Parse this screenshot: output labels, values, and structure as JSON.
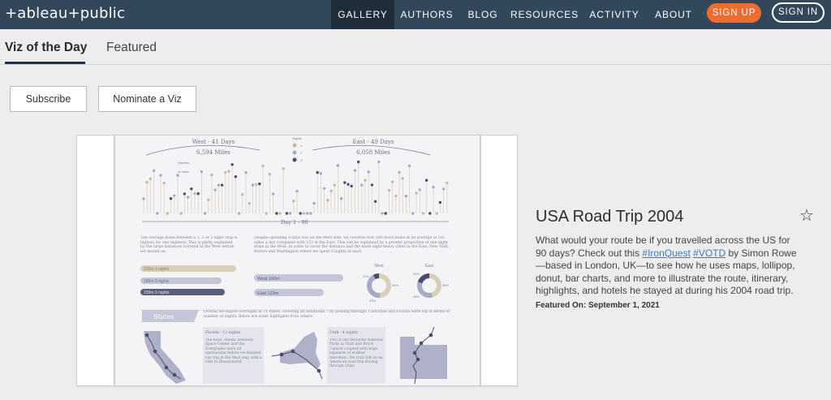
{
  "logo": {
    "text": "+ableau+public"
  },
  "nav": {
    "items": [
      "GALLERY",
      "AUTHORS",
      "BLOG",
      "RESOURCES",
      "ACTIVITY",
      "ABOUT"
    ],
    "sign_up": "SIGN UP",
    "sign_in": "SIGN IN"
  },
  "tabs": {
    "active": "Viz of the Day",
    "other": "Featured"
  },
  "actions": {
    "subscribe": "Subscribe",
    "nominate": "Nominate a Viz"
  },
  "viz": {
    "title": "USA Road Trip 2004",
    "desc_part1": "What would your route be if you travelled across the US for 90 days? Check out this ",
    "tag1": "#IronQuest",
    "tag2": "#VOTD",
    "desc_part2": " by Simon Rowe—based in London, UK—to see how he uses maps, lollipop, donut, bar charts, and more to illustrate the route, itinerary, highlights, and hotels he stayed at during his 2004 road trip.",
    "featured_on": "Featured On: September 1, 2021",
    "star_icon": "star-outline-icon"
  },
  "thumbnail": {
    "west_label": "West - 41 Days",
    "west_miles": "6,594 Miles",
    "east_label": "East - 49 Days",
    "east_miles": "6,058 Miles",
    "nights_label": "Nights",
    "nights_values": [
      "1",
      "2",
      "3"
    ],
    "number_label": "Number",
    "number_unit": "of miles",
    "axis_label": "Day 1 - 90",
    "left_text": "The average miles between a 1, 2 or 3 night stop is highest for one nighters. This is partly explained by the large distances covered in the West before we moved on.",
    "center_text": "Despite spending 8 days less on the West side, we covered over 500 more miles at an average of 161 miles a day compared with 123 in the East. This can be explained by a greater proportion of one night stops in the West, in order to cover the distance and the more sight-heavy cities in the East, New York, Boston and Washington where we spent 3 nights at each.",
    "bars": [
      "229m 1 nights",
      "186m 2 nights",
      "159m 3 nights"
    ],
    "west_bar": "West 160m",
    "east_bar": "East 123m",
    "donut_west": "West",
    "donut_east": "East",
    "donut_west_pcts": [
      "23%",
      "44%",
      "33%"
    ],
    "donut_east_pcts": [
      "20%",
      "35%",
      "45%"
    ],
    "states_title": "States",
    "states_text": "Overall we stayed overnight in 31 states, covering an additional 7 by passing through. California and Florida were top in terms of number of nights. Below are some highlights from others.",
    "florida_title": "Florida - 12 nights",
    "florida_text": "The Keys, Miami, Kennedy Space Center and the Everglades were all spectacular before we finished our trip in the West way, with a visit to Disneyworld.",
    "utah_title": "Utah - 4 nights",
    "utah_text": "Two of our favourite National Parks in Utah and Bryce Canyon coupled with huge expanses of endless interstate. We truly felt on an American road trip driving through Utah."
  }
}
